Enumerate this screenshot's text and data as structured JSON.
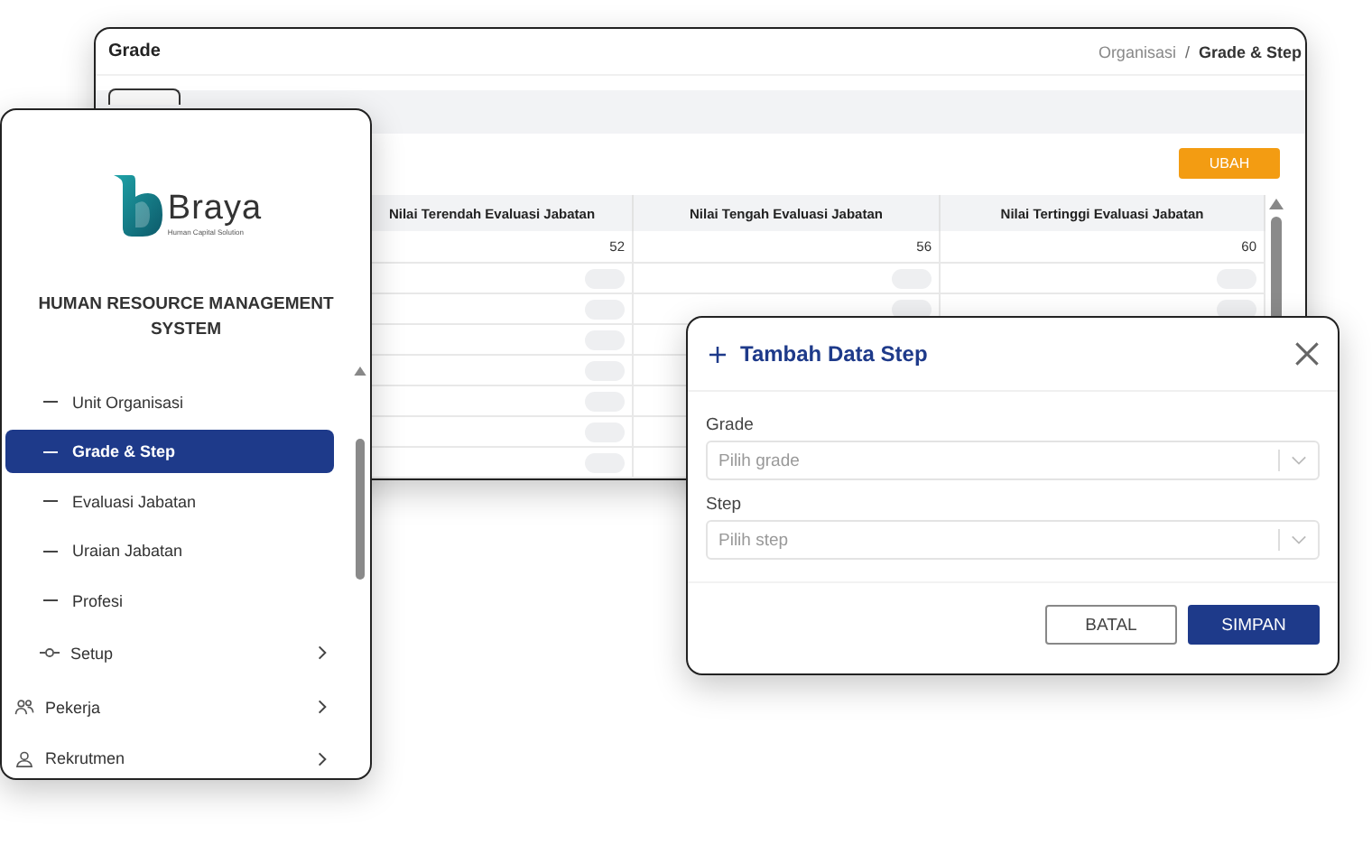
{
  "grade_window": {
    "title": "Grade",
    "breadcrumb_separator": "/",
    "breadcrumb": [
      {
        "label": "Organisasi",
        "current": false
      },
      {
        "label": "Grade & Step",
        "current": true
      }
    ],
    "edit_button": "UBAH",
    "table": {
      "columns": [
        "Nilai Terendah Evaluasi Jabatan",
        "Nilai Tengah Evaluasi Jabatan",
        "Nilai Tertinggi Evaluasi Jabatan"
      ],
      "rows": [
        {
          "cells": [
            {
              "loading": false,
              "text": "52"
            },
            {
              "loading": false,
              "text": "56"
            },
            {
              "loading": false,
              "text": "60"
            }
          ]
        },
        {
          "cells": [
            {
              "loading": true
            },
            {
              "loading": true
            },
            {
              "loading": true
            }
          ]
        },
        {
          "cells": [
            {
              "loading": true
            },
            {
              "loading": true
            },
            {
              "loading": true
            }
          ]
        },
        {
          "cells": [
            {
              "loading": true
            }
          ]
        },
        {
          "cells": [
            {
              "loading": true
            }
          ]
        },
        {
          "cells": [
            {
              "loading": true
            }
          ]
        },
        {
          "cells": [
            {
              "loading": true
            }
          ]
        },
        {
          "cells": [
            {
              "loading": true
            }
          ]
        }
      ]
    }
  },
  "sidebar": {
    "brand": "Braya",
    "tagline": "Human Capital Solution",
    "system_title": "HUMAN RESOURCE MANAGEMENT SYSTEM",
    "items": [
      {
        "kind": "leaf",
        "label": "Unit Organisasi",
        "selected": false
      },
      {
        "kind": "leaf",
        "label": "Grade & Step",
        "selected": true
      },
      {
        "kind": "leaf",
        "label": "Evaluasi Jabatan",
        "selected": false
      },
      {
        "kind": "leaf",
        "label": "Uraian Jabatan",
        "selected": false
      },
      {
        "kind": "leaf",
        "label": "Profesi",
        "selected": false
      },
      {
        "kind": "group",
        "label": "Setup",
        "selected": false,
        "expanded": false
      },
      {
        "kind": "module",
        "label": "Pekerja",
        "selected": false,
        "expanded": false
      },
      {
        "kind": "module",
        "label": "Rekrutmen",
        "selected": false,
        "expanded": false
      }
    ]
  },
  "dialog": {
    "title": "Tambah Data Step",
    "fields": [
      {
        "label": "Grade",
        "placeholder": "Pilih grade"
      },
      {
        "label": "Step",
        "placeholder": "Pilih step"
      }
    ],
    "buttons": [
      {
        "kind": "secondary",
        "label": "BATAL"
      },
      {
        "kind": "primary",
        "label": "SIMPAN"
      }
    ]
  }
}
